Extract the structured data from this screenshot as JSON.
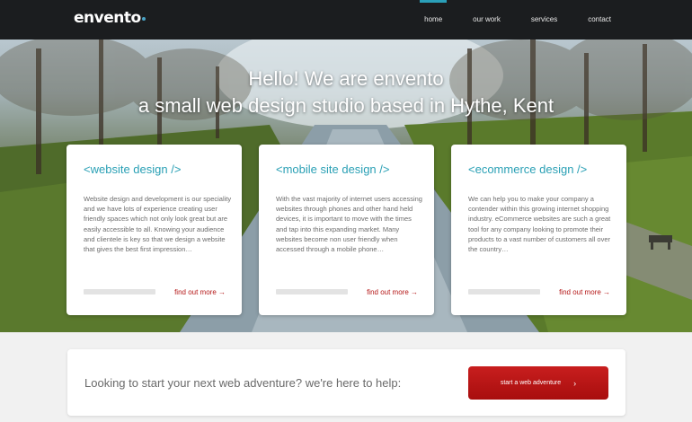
{
  "header": {
    "logo": "envento",
    "nav": [
      "home",
      "our work",
      "services",
      "contact"
    ],
    "active_nav": "home",
    "accent_color": "#2a9fb8"
  },
  "hero": {
    "line1": "Hello! We are envento",
    "line2": "a small web design studio based in Hythe, Kent"
  },
  "cards": [
    {
      "title": "<website design />",
      "text": "Website design and development is our speciality and we have lots of experience creating user friendly spaces which not only look great but are easily accessible to all. Knowing your audience and clientele is key so that we design a website that gives the best first impression…",
      "link": "find out more →"
    },
    {
      "title": "<mobile site design />",
      "text": "With the vast majority of internet users accessing websites through phones and other hand held devices, it is important to move with the times and tap into this expanding market. Many websites become non user friendly when accessed through a mobile phone…",
      "link": "find out more →"
    },
    {
      "title": "<ecommerce design />",
      "text": "We can help you to make your company a contender within this growing internet shopping industry. eCommerce websites are such a great tool for any company looking to promote their products to a vast number of customers all over the country…",
      "link": "find out more →"
    }
  ],
  "cta": {
    "text": "Looking to start your next web adventure? we're here to help:",
    "button": "start a web adventure",
    "button_icon": "chevron-right-icon",
    "button_color": "#b71414"
  }
}
